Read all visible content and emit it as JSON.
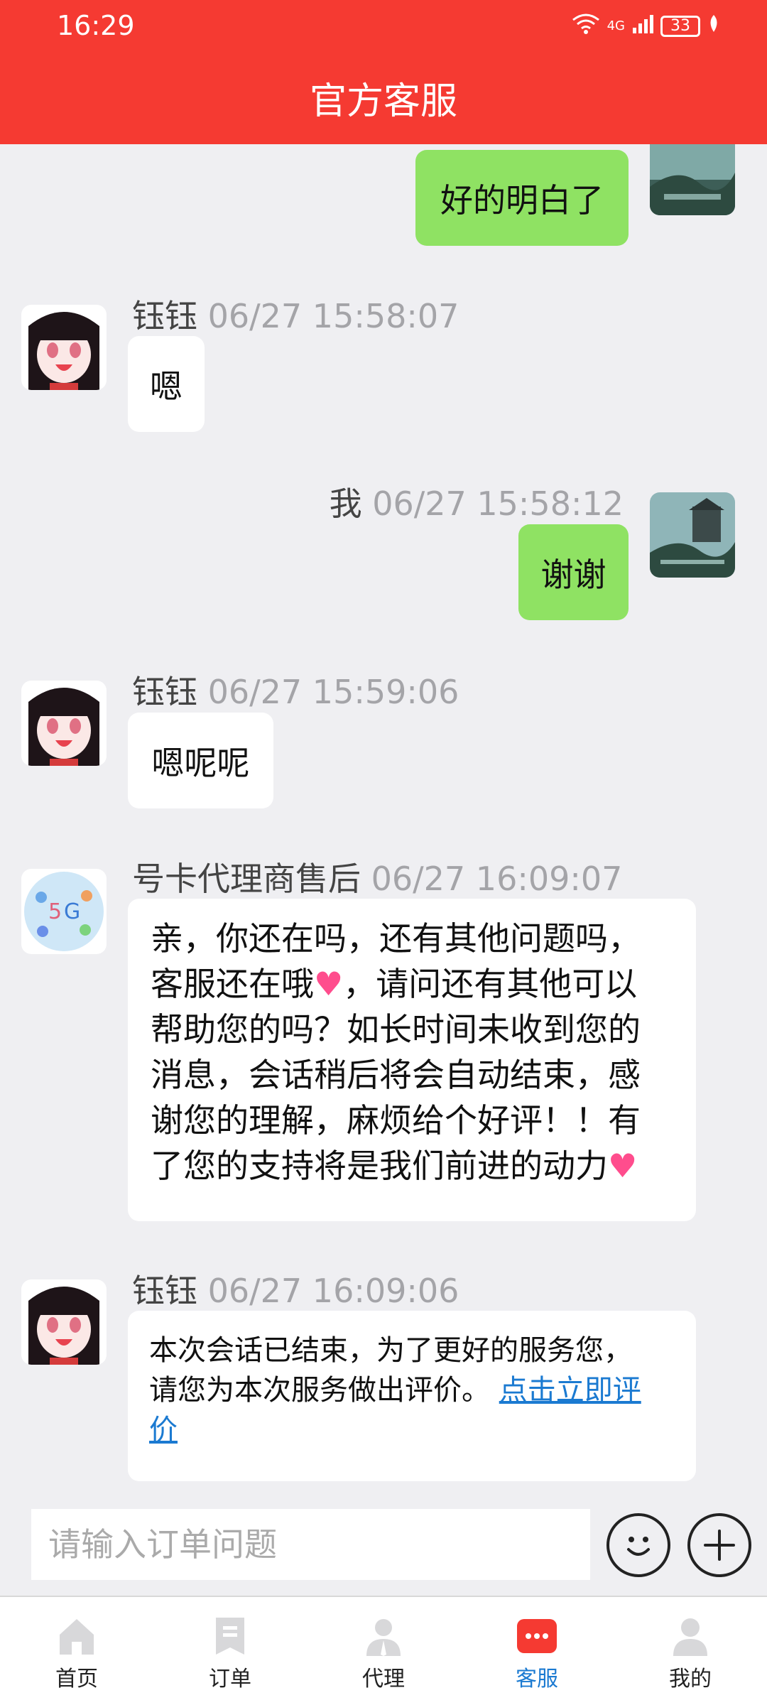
{
  "status_bar": {
    "time": "16:29",
    "network": "4G",
    "battery": "33"
  },
  "header": {
    "title": "官方客服"
  },
  "messages": [
    {
      "sender": "",
      "time": "",
      "text": "好的明白了"
    },
    {
      "sender": "钰钰",
      "time": "06/27 15:58:07",
      "text": "嗯"
    },
    {
      "sender": "我",
      "time": "06/27 15:58:12",
      "text": "谢谢"
    },
    {
      "sender": "钰钰",
      "time": "06/27 15:59:06",
      "text": "嗯呢呢"
    },
    {
      "sender": "号卡代理商售后",
      "time": "06/27 16:09:07",
      "lines": [
        "亲，你还在吗，还有其他问题吗，",
        "客服还在哦",
        "，请问还有其他可以",
        "帮助您的吗？如长时间未收到您的",
        "消息，会话稍后将会自动结束，感",
        "谢您的理解，麻烦给个好评！！有",
        "了您的支持将是我们前进的动力"
      ]
    },
    {
      "sender": "钰钰",
      "time": "06/27 16:09:06",
      "lines": [
        "本次会话已结束，为了更好的服务您，",
        "请您为本次服务做出评价。"
      ],
      "link_part1": "点击立即评",
      "link_part2": "价"
    }
  ],
  "input": {
    "placeholder": "请输入订单问题"
  },
  "nav": [
    {
      "label": "首页",
      "icon": "home-icon"
    },
    {
      "label": "订单",
      "icon": "order-icon"
    },
    {
      "label": "代理",
      "icon": "agent-icon"
    },
    {
      "label": "客服",
      "icon": "customer-service-icon",
      "active": true
    },
    {
      "label": "我的",
      "icon": "profile-icon"
    }
  ],
  "colors": {
    "header": "#f53a32",
    "my_bubble": "#8fe263",
    "link": "#1b7ad1",
    "active_nav": "#1b7ad1"
  }
}
